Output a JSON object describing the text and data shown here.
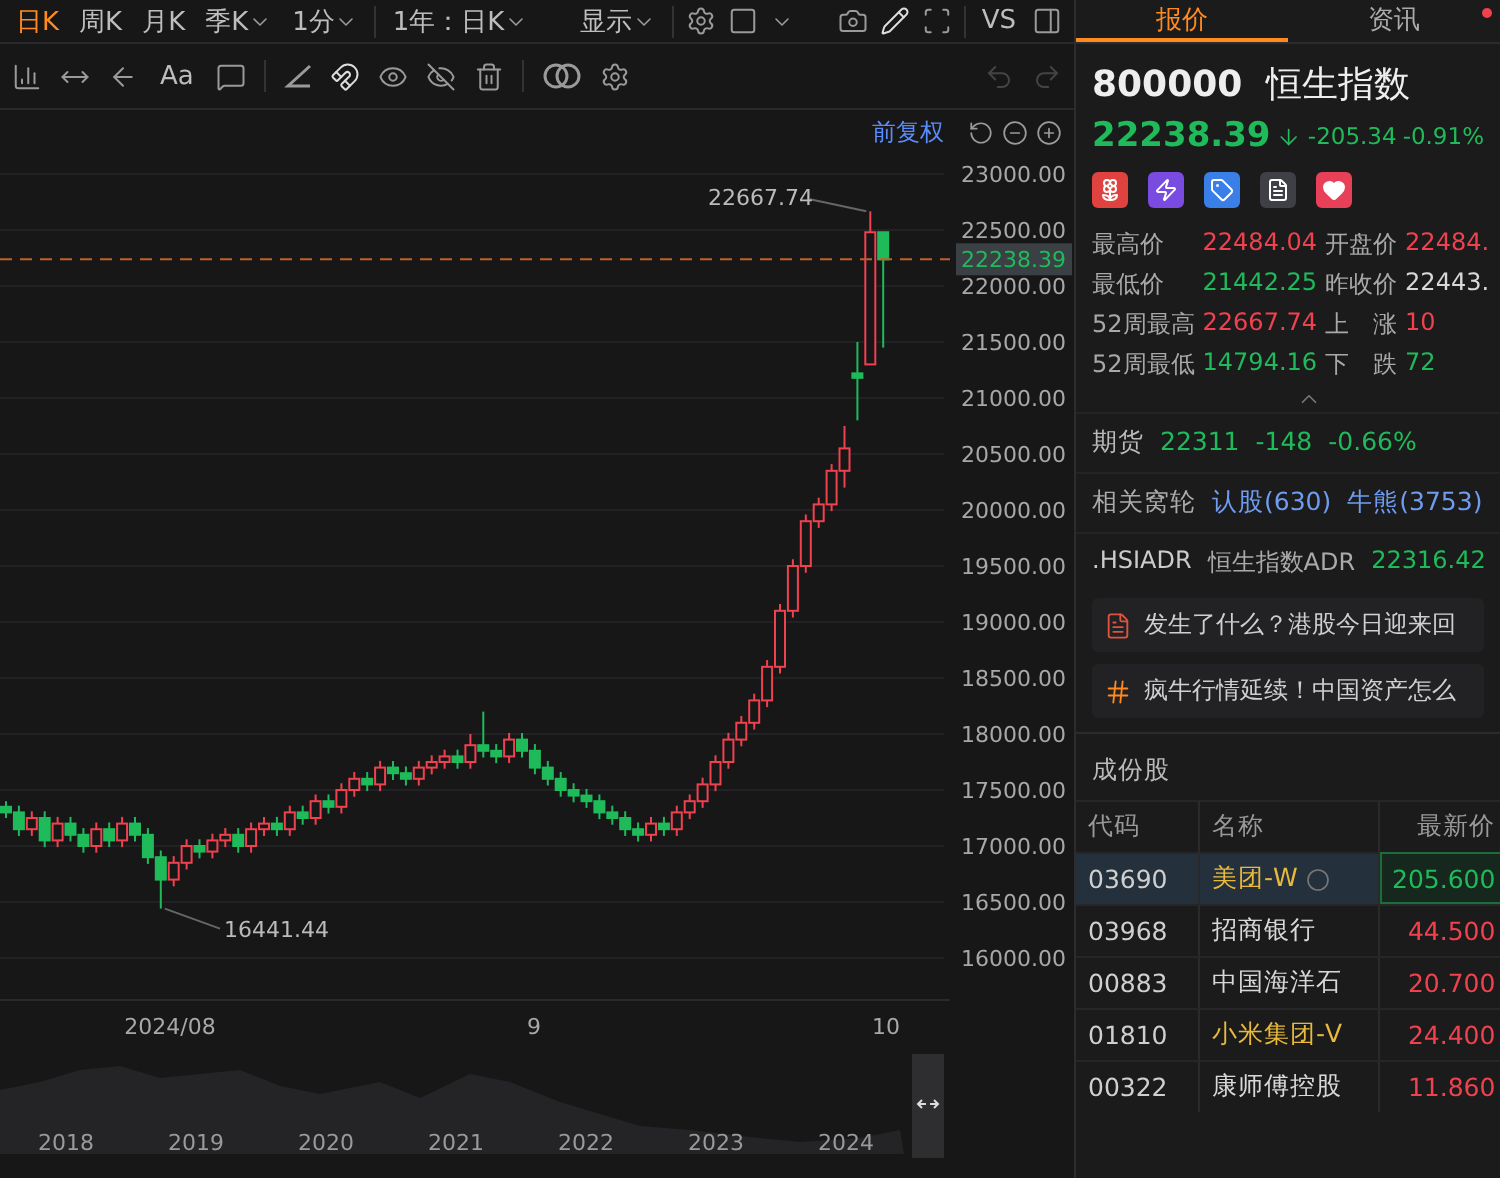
{
  "toolbar": {
    "periods": [
      {
        "label": "日K",
        "selected": true,
        "dropdown": false
      },
      {
        "label": "周K",
        "selected": false,
        "dropdown": false
      },
      {
        "label": "月K",
        "selected": false,
        "dropdown": false
      },
      {
        "label": "季K",
        "selected": false,
        "dropdown": true
      },
      {
        "label": "1分",
        "selected": false,
        "dropdown": true
      }
    ],
    "range": "1年：日K",
    "display": "显示",
    "vs": "VS",
    "text_tool": "Aa"
  },
  "chart": {
    "adjust": "前复权",
    "high_label": "22667.74",
    "low_label": "16441.44",
    "x_labels": [
      "2024/08",
      "9",
      "10"
    ],
    "navigator_years": [
      "2018",
      "2019",
      "2020",
      "2021",
      "2022",
      "2023",
      "2024"
    ],
    "chart_data": {
      "type": "candlestick",
      "ylim": [
        16000,
        23000
      ],
      "grid": true,
      "ref_lines": [
        {
          "axis": "y",
          "value": 22238.39,
          "label": "22238.39",
          "color": "#c0602a"
        }
      ],
      "yticks": [
        {
          "value": 23000,
          "label": "23000.00"
        },
        {
          "value": 22500,
          "label": "22500.00"
        },
        {
          "value": 22000,
          "label": "22000.00"
        },
        {
          "value": 21500,
          "label": "21500.00"
        },
        {
          "value": 21000,
          "label": "21000.00"
        },
        {
          "value": 20500,
          "label": "20500.00"
        },
        {
          "value": 20000,
          "label": "20000.00"
        },
        {
          "value": 19500,
          "label": "19500.00"
        },
        {
          "value": 19000,
          "label": "19000.00"
        },
        {
          "value": 18500,
          "label": "18500.00"
        },
        {
          "value": 18000,
          "label": "18000.00"
        },
        {
          "value": 17500,
          "label": "17500.00"
        },
        {
          "value": 17000,
          "label": "17000.00"
        },
        {
          "value": 16500,
          "label": "16500.00"
        },
        {
          "value": 16000,
          "label": "16000.00"
        }
      ],
      "ohlc": [
        [
          17350,
          17400,
          17250,
          17300
        ],
        [
          17300,
          17360,
          17090,
          17150
        ],
        [
          17150,
          17310,
          17090,
          17250
        ],
        [
          17250,
          17310,
          16990,
          17050
        ],
        [
          17050,
          17260,
          16990,
          17200
        ],
        [
          17200,
          17260,
          17040,
          17100
        ],
        [
          17100,
          17160,
          16940,
          17000
        ],
        [
          17000,
          17210,
          16940,
          17150
        ],
        [
          17150,
          17210,
          16990,
          17050
        ],
        [
          17050,
          17260,
          16990,
          17200
        ],
        [
          17200,
          17260,
          17040,
          17100
        ],
        [
          17100,
          17160,
          16840,
          16900
        ],
        [
          16900,
          16960,
          16441,
          16700
        ],
        [
          16700,
          16910,
          16640,
          16850
        ],
        [
          16850,
          17060,
          16790,
          17000
        ],
        [
          17000,
          17060,
          16890,
          16950
        ],
        [
          16950,
          17110,
          16890,
          17050
        ],
        [
          17050,
          17160,
          16990,
          17100
        ],
        [
          17100,
          17160,
          16940,
          17000
        ],
        [
          17000,
          17210,
          16940,
          17150
        ],
        [
          17150,
          17260,
          17090,
          17200
        ],
        [
          17200,
          17260,
          17090,
          17150
        ],
        [
          17150,
          17360,
          17090,
          17300
        ],
        [
          17300,
          17360,
          17190,
          17250
        ],
        [
          17250,
          17460,
          17190,
          17400
        ],
        [
          17400,
          17460,
          17290,
          17350
        ],
        [
          17350,
          17560,
          17290,
          17500
        ],
        [
          17500,
          17660,
          17440,
          17600
        ],
        [
          17600,
          17660,
          17490,
          17550
        ],
        [
          17550,
          17760,
          17490,
          17700
        ],
        [
          17700,
          17760,
          17590,
          17650
        ],
        [
          17650,
          17710,
          17540,
          17600
        ],
        [
          17600,
          17760,
          17540,
          17700
        ],
        [
          17700,
          17810,
          17640,
          17750
        ],
        [
          17750,
          17860,
          17690,
          17800
        ],
        [
          17800,
          17860,
          17690,
          17750
        ],
        [
          17750,
          18000,
          17690,
          17900
        ],
        [
          17900,
          18200,
          17790,
          17850
        ],
        [
          17850,
          17910,
          17740,
          17800
        ],
        [
          17800,
          18010,
          17740,
          17950
        ],
        [
          17950,
          18010,
          17790,
          17850
        ],
        [
          17850,
          17910,
          17640,
          17700
        ],
        [
          17700,
          17760,
          17540,
          17600
        ],
        [
          17600,
          17660,
          17440,
          17500
        ],
        [
          17500,
          17560,
          17390,
          17450
        ],
        [
          17450,
          17510,
          17340,
          17400
        ],
        [
          17400,
          17460,
          17240,
          17300
        ],
        [
          17300,
          17360,
          17190,
          17250
        ],
        [
          17250,
          17310,
          17090,
          17150
        ],
        [
          17150,
          17210,
          17040,
          17100
        ],
        [
          17100,
          17260,
          17040,
          17200
        ],
        [
          17200,
          17260,
          17090,
          17150
        ],
        [
          17150,
          17360,
          17090,
          17300
        ],
        [
          17300,
          17460,
          17240,
          17400
        ],
        [
          17400,
          17610,
          17340,
          17550
        ],
        [
          17550,
          17810,
          17490,
          17750
        ],
        [
          17750,
          18010,
          17690,
          17950
        ],
        [
          17950,
          18160,
          17890,
          18100
        ],
        [
          18100,
          18360,
          18040,
          18300
        ],
        [
          18300,
          18660,
          18240,
          18600
        ],
        [
          18600,
          19160,
          18540,
          19100
        ],
        [
          19100,
          19560,
          19040,
          19500
        ],
        [
          19500,
          19960,
          19440,
          19900
        ],
        [
          19900,
          20110,
          19840,
          20050
        ],
        [
          20050,
          20410,
          19990,
          20350
        ],
        [
          20350,
          20750,
          20200,
          20550
        ],
        [
          21220,
          21500,
          20800,
          21180
        ],
        [
          21300,
          22667,
          21300,
          22480
        ],
        [
          22480,
          22480,
          21450,
          22238
        ]
      ]
    }
  },
  "panel": {
    "tabs": [
      {
        "label": "报价",
        "selected": true,
        "dot": false
      },
      {
        "label": "资讯",
        "selected": false,
        "dot": true
      }
    ],
    "code": "800000",
    "name": "恒生指数",
    "quote": {
      "price": "22238.39",
      "change": "-205.34",
      "change_pct": "-0.91%",
      "color": "#1fbb5a"
    },
    "stats": [
      {
        "label": "最高价",
        "value": "22484.04",
        "color": "#f0414f"
      },
      {
        "label": "开盘价",
        "value": "22484.",
        "color": "#f0414f"
      },
      {
        "label": "最低价",
        "value": "21442.25",
        "color": "#1fbb5a"
      },
      {
        "label": "昨收价",
        "value": "22443.",
        "color": "#d8d8d8"
      },
      {
        "label": "52周最高",
        "value": "22667.74",
        "color": "#f0414f"
      },
      {
        "label": "上　涨",
        "value": "10",
        "color": "#f0414f"
      },
      {
        "label": "52周最低",
        "value": "14794.16",
        "color": "#1fbb5a"
      },
      {
        "label": "下　跌",
        "value": "72",
        "color": "#1fbb5a"
      }
    ],
    "futures": {
      "label": "期货",
      "value": "22311",
      "change": "-148",
      "change_pct": "-0.66%",
      "color": "#1fbb5a"
    },
    "warrants": {
      "label": "相关窝轮",
      "links": [
        "认股(630)",
        "牛熊(3753)"
      ]
    },
    "adr": {
      "code": ".HSIADR",
      "name": "恒生指数ADR",
      "value": "22316.42",
      "color": "#1fbb5a"
    },
    "news": [
      {
        "kind": "doc",
        "text": "发生了什么？港股今日迎来回"
      },
      {
        "kind": "topic",
        "text": "疯牛行情延续！中国资产怎么"
      }
    ],
    "constituents": {
      "title": "成份股",
      "columns": [
        "代码",
        "名称",
        "最新价"
      ],
      "rows": [
        {
          "code": "03690",
          "name": {
            "text": "美团-W",
            "color": "#e8b93a"
          },
          "price": {
            "text": "205.600",
            "color": "#1fbb5a"
          },
          "selected": true,
          "watched": true
        },
        {
          "code": "03968",
          "name": {
            "text": "招商银行",
            "color": "#d8d8d8"
          },
          "price": {
            "text": "44.500",
            "color": "#f0414f"
          },
          "selected": false,
          "watched": false
        },
        {
          "code": "00883",
          "name": {
            "text": "中国海洋石",
            "color": "#d8d8d8"
          },
          "price": {
            "text": "20.700",
            "color": "#f0414f"
          },
          "selected": false,
          "watched": false
        },
        {
          "code": "01810",
          "name": {
            "text": "小米集团-V",
            "color": "#e8b93a"
          },
          "price": {
            "text": "24.400",
            "color": "#f0414f"
          },
          "selected": false,
          "watched": false
        },
        {
          "code": "00322",
          "name": {
            "text": "康师傅控股",
            "color": "#d8d8d8"
          },
          "price": {
            "text": "11.860",
            "color": "#f0414f"
          },
          "selected": false,
          "watched": false
        }
      ]
    }
  }
}
